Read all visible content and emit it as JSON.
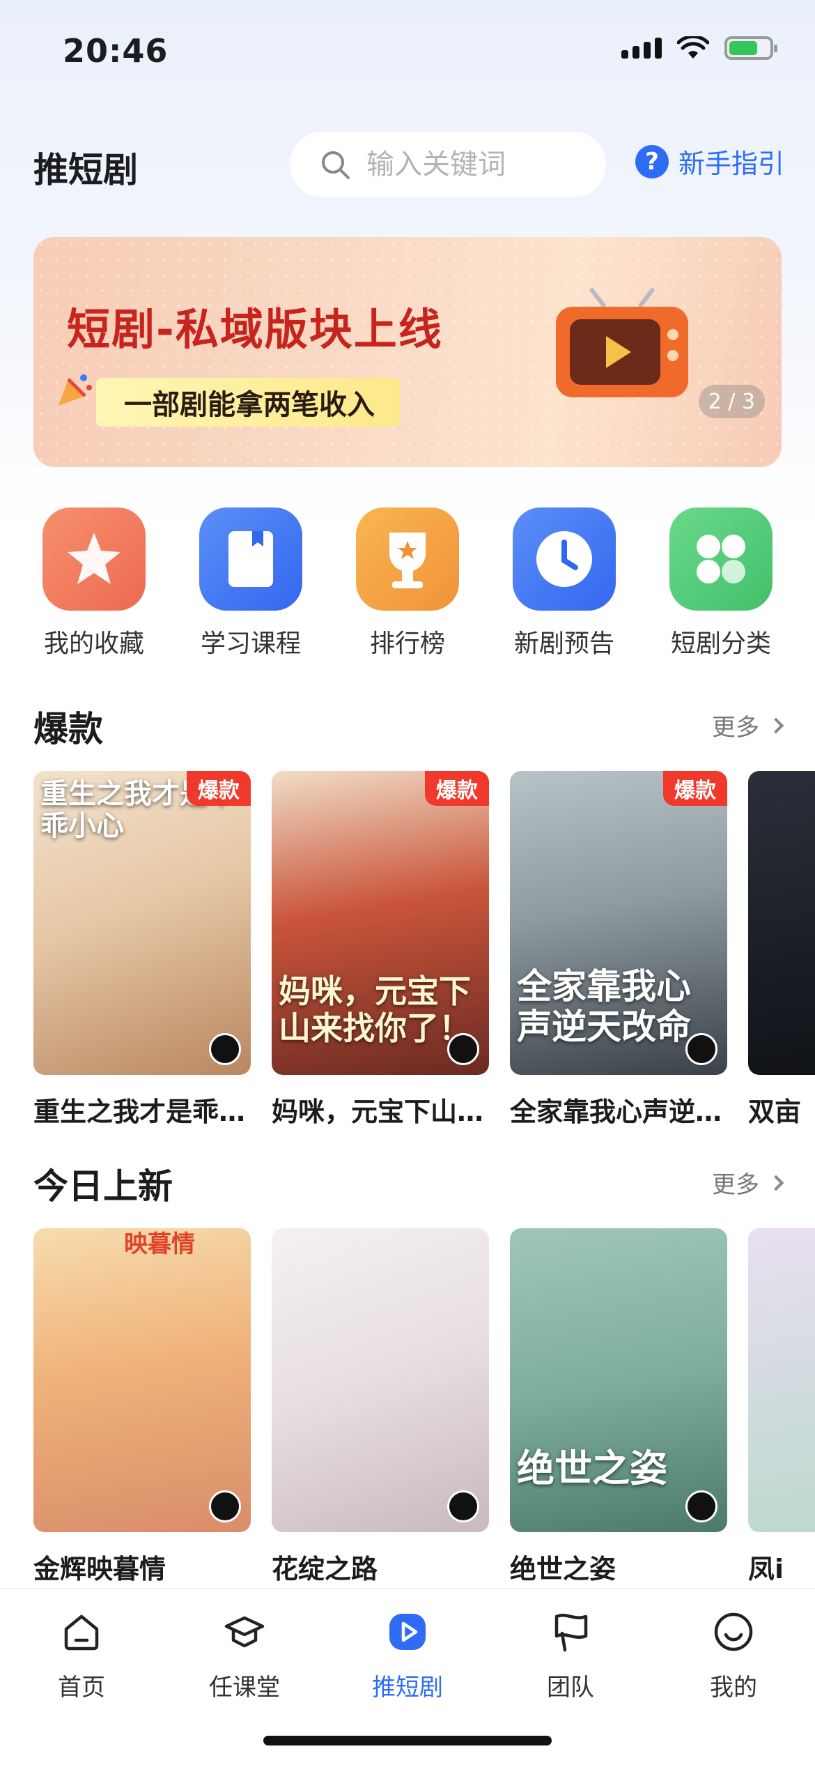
{
  "status_bar": {
    "time": "20:46"
  },
  "header": {
    "title": "推短剧",
    "search_placeholder": "输入关键词",
    "guide_label": "新手指引"
  },
  "banner": {
    "title": "短剧-私域版块上线",
    "subtitle": "一部剧能拿两笔收入",
    "counter": "2 / 3"
  },
  "quick_nav": [
    {
      "label": "我的收藏",
      "icon": "star-icon",
      "color": "#f27a5e"
    },
    {
      "label": "学习课程",
      "icon": "book-icon",
      "color": "#3e7af5"
    },
    {
      "label": "排行榜",
      "icon": "trophy-icon",
      "color": "#f4a23c"
    },
    {
      "label": "新剧预告",
      "icon": "clock-icon",
      "color": "#3e7af5"
    },
    {
      "label": "短剧分类",
      "icon": "grid-icon",
      "color": "#4ecb72"
    }
  ],
  "hot": {
    "title": "爆款",
    "more": "更多",
    "tag": "爆款",
    "cards": [
      {
        "title": "重生之我才是乖…",
        "poster_text": "重生之我才是乖乖小心"
      },
      {
        "title": "妈咪，元宝下山…",
        "poster_text": "妈咪，元宝下山来找你了！"
      },
      {
        "title": "全家靠我心声逆…",
        "poster_text": "全家靠我心声逆天改命"
      },
      {
        "title": "双亩"
      }
    ]
  },
  "new_today": {
    "title": "今日上新",
    "more": "更多",
    "cards": [
      {
        "title": "金辉映暮情",
        "poster_text": "映暮情"
      },
      {
        "title": "花绽之路"
      },
      {
        "title": "绝世之姿",
        "poster_text": "绝世之姿"
      },
      {
        "title": "凤i"
      }
    ]
  },
  "tab_bar": [
    {
      "label": "首页",
      "icon": "home-icon",
      "active": false
    },
    {
      "label": "任课堂",
      "icon": "graduation-cap-icon",
      "active": false
    },
    {
      "label": "推短剧",
      "icon": "play-icon",
      "active": true
    },
    {
      "label": "团队",
      "icon": "flag-icon",
      "active": false
    },
    {
      "label": "我的",
      "icon": "smile-icon",
      "active": false
    }
  ],
  "colors": {
    "accent": "#2e6cf6",
    "hot_tag": "#ef3a2b",
    "banner_title": "#c8241e"
  }
}
